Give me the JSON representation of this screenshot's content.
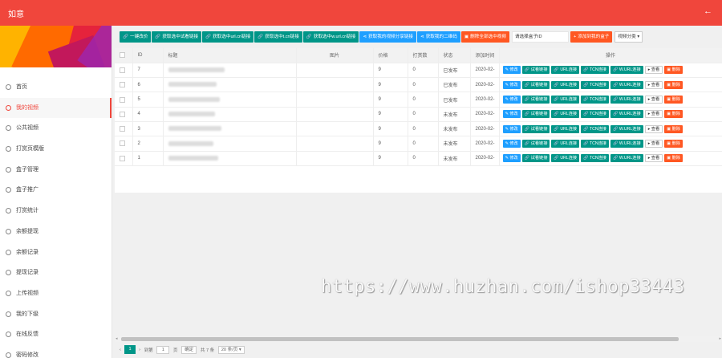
{
  "header": {
    "brand": "如意",
    "back_icon": "←"
  },
  "sidebar": {
    "items": [
      {
        "label": "首页"
      },
      {
        "label": "我的视频",
        "active": true
      },
      {
        "label": "公共视频"
      },
      {
        "label": "打赏页模版"
      },
      {
        "label": "盒子管理"
      },
      {
        "label": "盒子推广"
      },
      {
        "label": "打赏统计"
      },
      {
        "label": "余额提现"
      },
      {
        "label": "余额记录"
      },
      {
        "label": "提现记录"
      },
      {
        "label": "上传视频"
      },
      {
        "label": "我的下级"
      },
      {
        "label": "在线反馈"
      },
      {
        "label": "密码修改"
      }
    ]
  },
  "toolbar": {
    "buttons": [
      "一键改价",
      "获取选中试看链接",
      "获取选中url.cn链接",
      "获取选中t.cn链接",
      "获取选中w.url.cn链接",
      "获取我的视频分享链接",
      "获取我的二维码",
      "删除全部选中视频"
    ],
    "search_placeholder": "请选择盒子ID",
    "add_button": "添加到我的盒子",
    "category_select": "视频分类"
  },
  "table": {
    "columns": [
      "ID",
      "标题",
      "图片",
      "价格",
      "打赏数",
      "状态",
      "添加时间",
      "操作"
    ],
    "rows": [
      {
        "id": "7",
        "price": "9",
        "count": "0",
        "status": "已发布",
        "time": "2020-02-"
      },
      {
        "id": "6",
        "price": "9",
        "count": "0",
        "status": "已发布",
        "time": "2020-02-"
      },
      {
        "id": "5",
        "price": "9",
        "count": "0",
        "status": "已发布",
        "time": "2020-02-"
      },
      {
        "id": "4",
        "price": "9",
        "count": "0",
        "status": "未发布",
        "time": "2020-02-"
      },
      {
        "id": "3",
        "price": "9",
        "count": "0",
        "status": "未发布",
        "time": "2020-02-"
      },
      {
        "id": "2",
        "price": "9",
        "count": "0",
        "status": "未发布",
        "time": "2020-02-"
      },
      {
        "id": "1",
        "price": "9",
        "count": "0",
        "status": "未发布",
        "time": "2020-02-"
      }
    ],
    "ops": [
      "修改",
      "试看链接",
      "URL连接",
      "TCN连接",
      "W.URL连接",
      "查看",
      "删除"
    ]
  },
  "pager": {
    "current": "1",
    "goto": "到第",
    "page_input": "1",
    "page_unit": "页",
    "confirm": "确定",
    "total": "共 7 条",
    "per_page": "20 条/页"
  },
  "watermark": "https://www.huzhan.com/ishop33443"
}
